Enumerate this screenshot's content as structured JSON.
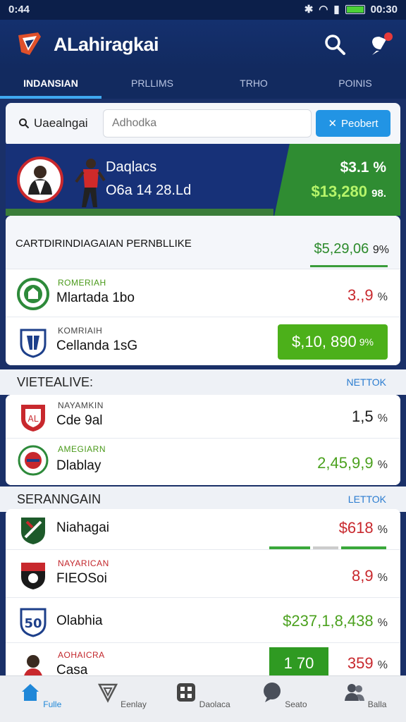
{
  "status": {
    "time": "0:44",
    "clock": "00:30"
  },
  "app": {
    "title": "ALahiragkai"
  },
  "tabs": [
    {
      "label": "INDANSIAN",
      "active": true
    },
    {
      "label": "PRLLIMS",
      "active": false
    },
    {
      "label": "TRHO",
      "active": false
    },
    {
      "label": "POINIS",
      "active": false
    }
  ],
  "search": {
    "label": "Uaealngai",
    "placeholder": "Adhodka",
    "button": "Peobert"
  },
  "hero": {
    "name": "Daqlacs",
    "sub": "O6a 14 28.Ld",
    "pct": "$3.1 %",
    "value": "$13,280",
    "value_suffix": "98."
  },
  "section1": {
    "title": "CARTDIRINDIAGAIAN PERNBLLIKE",
    "value": "$5,29,06",
    "value_suffix": "9%",
    "rows": [
      {
        "small": "ROMERIAH",
        "name": "Mlartada 1bo",
        "value": "3.,9",
        "suffix": "%",
        "style": "red",
        "crest": "green"
      },
      {
        "small": "KOMRIAIH",
        "name": "Cellanda 1sG",
        "value": "$,10, 890",
        "suffix": "9%",
        "style": "pill",
        "crest": "blue"
      }
    ]
  },
  "section2": {
    "title": "VIETEALIVE:",
    "link": "NETTOK",
    "rows": [
      {
        "small": "NAYAMKIN",
        "name": "Cde 9al",
        "value": "1,5",
        "suffix": "%",
        "style": "dark",
        "crest": "red"
      },
      {
        "small": "AMEGIARN",
        "name": "Dlablay",
        "value": "2,45,9,9",
        "suffix": "%",
        "style": "green",
        "crest": "mixed"
      }
    ]
  },
  "section3": {
    "title": "SERANNGAIN",
    "link": "LETTOK",
    "rows": [
      {
        "small": "",
        "name": "Niahagai",
        "value": "$618",
        "suffix": "%",
        "style": "red",
        "crest": "green"
      },
      {
        "small": "NAYARICAN",
        "name": "FIEOSoi",
        "value": "8,9",
        "suffix": "%",
        "style": "red",
        "crest": "redblack"
      },
      {
        "small": "",
        "name": "Olabhia",
        "value": "$237,1,8,438",
        "suffix": "%",
        "style": "green",
        "crest": "num"
      },
      {
        "small": "AOHAICRA",
        "name": "Casa",
        "value": "359",
        "suffix": "%",
        "style": "red",
        "crest": "player",
        "pill": "1 70"
      }
    ]
  },
  "nav": [
    {
      "label": "Fulle",
      "active": true,
      "icon": "home-icon"
    },
    {
      "label": "Eenlay",
      "active": false,
      "icon": "shield-icon"
    },
    {
      "label": "Daolaca",
      "active": false,
      "icon": "grid-icon"
    },
    {
      "label": "Seato",
      "active": false,
      "icon": "chat-icon"
    },
    {
      "label": "Balla",
      "active": false,
      "icon": "people-icon"
    }
  ]
}
